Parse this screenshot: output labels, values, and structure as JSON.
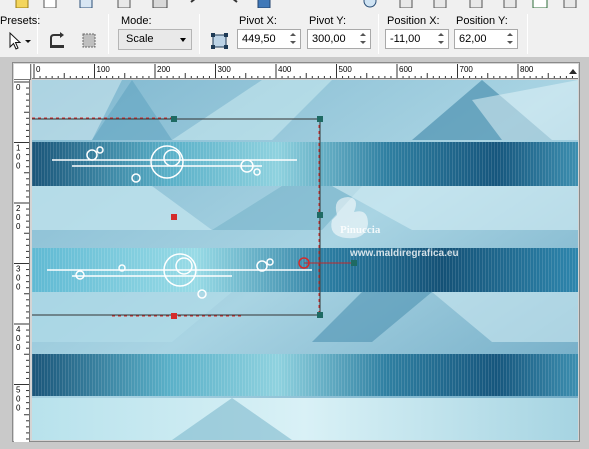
{
  "toolbar": {
    "presets_label": "Presets:",
    "mode_label": "Mode:",
    "mode_value": "Scale",
    "pivot_x_label": "Pivot X:",
    "pivot_x_value": "449,50",
    "pivot_y_label": "Pivot Y:",
    "pivot_y_value": "300,00",
    "position_x_label": "Position X:",
    "position_x_value": "-11,00",
    "position_y_label": "Position Y:",
    "position_y_value": "62,00"
  },
  "rulers": {
    "horizontal_ticks": [
      "0",
      "100",
      "200",
      "300",
      "400",
      "500",
      "600",
      "700",
      "800"
    ],
    "vertical_ticks": [
      "0",
      "1\n0\n0",
      "2\n0\n0",
      "3\n0\n0",
      "4\n0\n0",
      "5\n0\n0"
    ]
  },
  "watermark": {
    "line1": "Pinuccia",
    "line2": "www.maldiregrafica.eu"
  },
  "colors": {
    "accent_blue": "#1d5f86",
    "handle_teal": "#1e6a63",
    "handle_red": "#d42b2b",
    "selection_line": "#2f2f2f"
  }
}
